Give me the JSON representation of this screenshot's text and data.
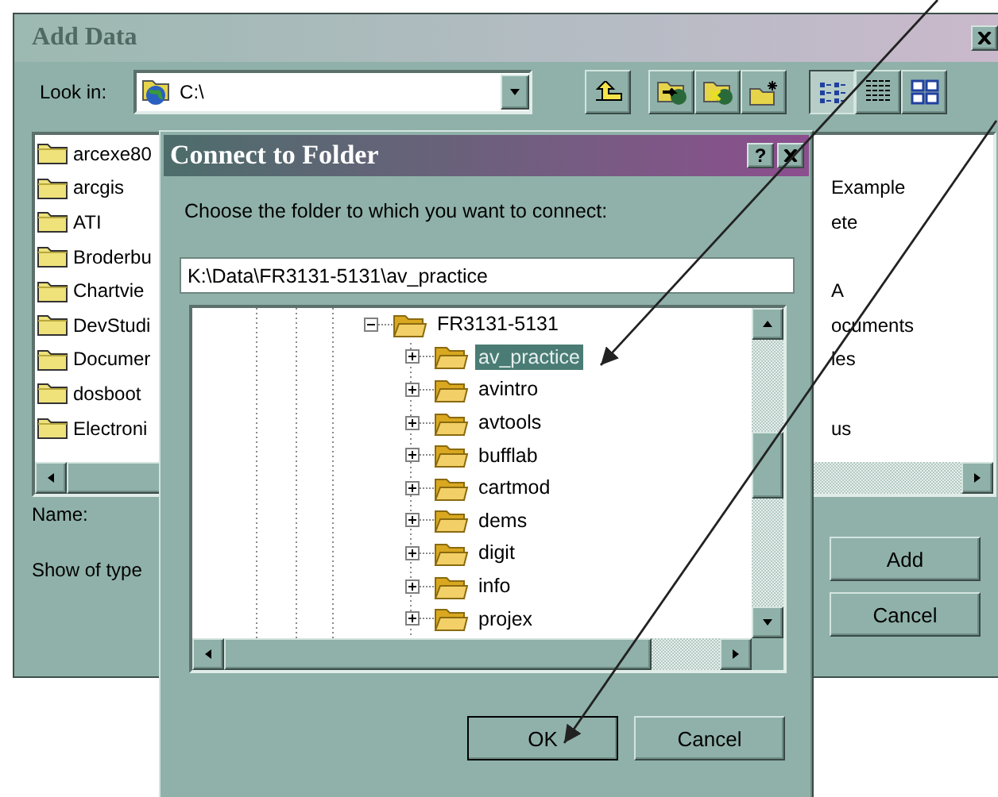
{
  "add_data": {
    "title": "Add Data",
    "look_in": {
      "label": "Look in:",
      "value": "C:\\"
    },
    "tools": [
      {
        "kind": "up"
      },
      {
        "kind": "connect"
      },
      {
        "kind": "disconnect"
      },
      {
        "kind": "new_folder"
      }
    ],
    "views": [
      {
        "kind": "list",
        "selected": true
      },
      {
        "kind": "details",
        "selected": false
      },
      {
        "kind": "thumbnails",
        "selected": false
      }
    ],
    "file_rows": [
      {
        "column_1": "arcexe80"
      },
      {
        "column_1": "arcgis",
        "column_2": "Example"
      },
      {
        "column_1": "ATI",
        "column_2": "ete"
      },
      {
        "column_1": "Broderbu"
      },
      {
        "column_1": "Chartvie",
        "column_2": "A"
      },
      {
        "column_1": "DevStudi",
        "column_2": "ocuments"
      },
      {
        "column_1": "Documer",
        "column_2": "les"
      },
      {
        "column_1": "dosboot"
      },
      {
        "column_1": "Electroni",
        "column_2": "us"
      }
    ],
    "name_label": "Name:",
    "type_label": "Show of type",
    "buttons": [
      "Add",
      "Cancel"
    ]
  },
  "connect_dialog": {
    "title": "Connect to Folder",
    "help": "?",
    "prompt": "Choose the folder to which you want to connect:",
    "path": "K:\\Data\\FR3131-5131\\av_practice",
    "tree": [
      {
        "name": "FR3131-5131",
        "expanded": true,
        "selected": false,
        "children": [
          {
            "name": "av_practice",
            "expanded": false,
            "selected": true
          },
          {
            "name": "avintro",
            "expanded": false,
            "selected": false
          },
          {
            "name": "avtools",
            "expanded": false,
            "selected": false
          },
          {
            "name": "bufflab",
            "expanded": false,
            "selected": false
          },
          {
            "name": "cartmod",
            "expanded": false,
            "selected": false
          },
          {
            "name": "dems",
            "expanded": false,
            "selected": false
          },
          {
            "name": "digit",
            "expanded": false,
            "selected": false
          },
          {
            "name": "info",
            "expanded": false,
            "selected": false
          },
          {
            "name": "projex",
            "expanded": false,
            "selected": false
          }
        ]
      }
    ],
    "buttons": [
      {
        "label": "OK",
        "default": true
      },
      {
        "label": "Cancel",
        "default": false
      }
    ]
  }
}
